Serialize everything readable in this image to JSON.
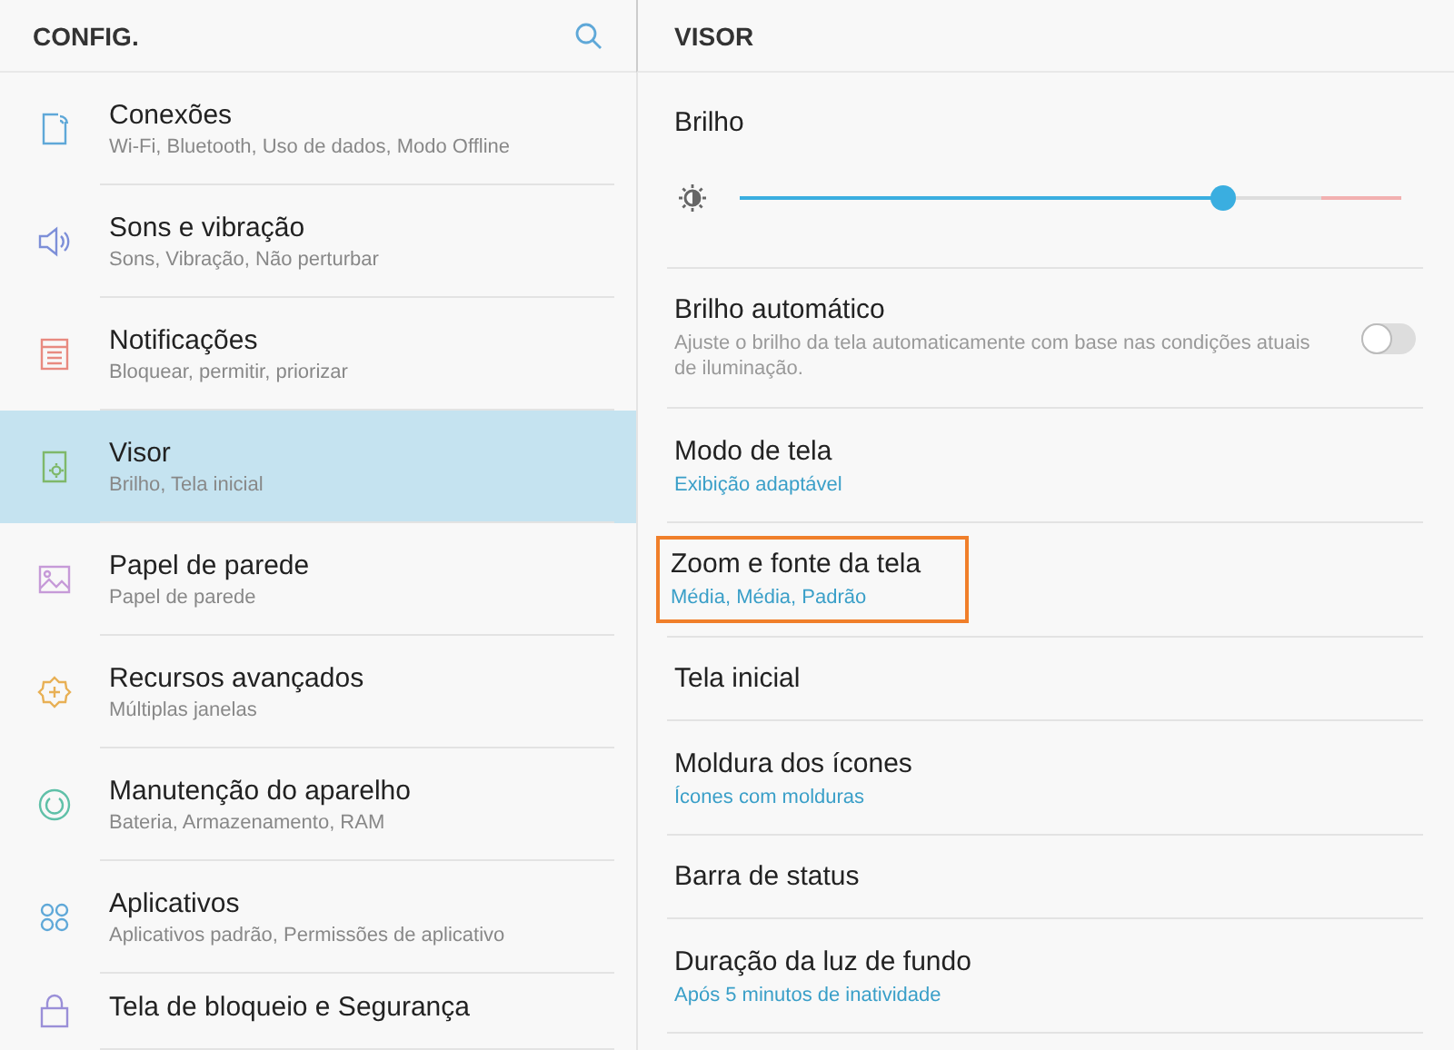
{
  "sidebar": {
    "title": "CONFIG.",
    "items": [
      {
        "color": "#5fa8d8",
        "title": "Conexões",
        "subtitle": "Wi-Fi, Bluetooth, Uso de dados, Modo Offline",
        "selected": false
      },
      {
        "color": "#7d8fd8",
        "title": "Sons e vibração",
        "subtitle": "Sons, Vibração, Não perturbar",
        "selected": false
      },
      {
        "color": "#e88a80",
        "title": "Notificações",
        "subtitle": "Bloquear, permitir, priorizar",
        "selected": false
      },
      {
        "color": "#7fb86a",
        "title": "Visor",
        "subtitle": "Brilho, Tela inicial",
        "selected": true
      },
      {
        "color": "#c69ad8",
        "title": "Papel de parede",
        "subtitle": "Papel de parede",
        "selected": false
      },
      {
        "color": "#e8b055",
        "title": "Recursos avançados",
        "subtitle": "Múltiplas janelas",
        "selected": false
      },
      {
        "color": "#5fc0a8",
        "title": "Manutenção do aparelho",
        "subtitle": "Bateria, Armazenamento, RAM",
        "selected": false
      },
      {
        "color": "#5fa8d8",
        "title": "Aplicativos",
        "subtitle": "Aplicativos padrão, Permissões de aplicativo",
        "selected": false
      },
      {
        "color": "#9a8fd8",
        "title": "Tela de bloqueio e Segurança",
        "selected": false
      }
    ]
  },
  "panel": {
    "title": "VISOR",
    "items": [
      {
        "kind": "slider",
        "title": "Brilho",
        "level": 0.73
      },
      {
        "kind": "toggle",
        "title": "Brilho automático",
        "description": "Ajuste o brilho da tela automaticamente com base nas condições atuais de iluminação.",
        "on": false
      },
      {
        "kind": "setting",
        "title": "Modo de tela",
        "value": "Exibição adaptável",
        "highlighted": false
      },
      {
        "kind": "setting",
        "title": "Zoom e fonte da tela",
        "value": "Média, Média, Padrão",
        "highlighted": true
      },
      {
        "kind": "setting",
        "title": "Tela inicial",
        "highlighted": false
      },
      {
        "kind": "setting",
        "title": "Moldura dos ícones",
        "value": "Ícones com molduras",
        "highlighted": false
      },
      {
        "kind": "setting",
        "title": "Barra de status",
        "highlighted": false
      },
      {
        "kind": "setting",
        "title": "Duração da luz de fundo",
        "value": "Após 5 minutos de inatividade",
        "highlighted": false
      }
    ]
  }
}
